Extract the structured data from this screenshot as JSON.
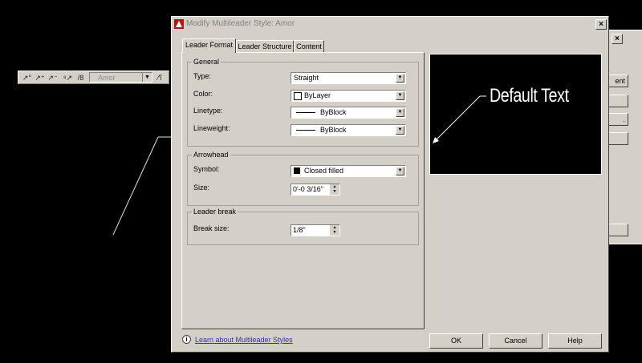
{
  "dialog": {
    "title": "Modify Multileader Style: Amor",
    "close_label": "×"
  },
  "tabs": [
    {
      "label": "Leader Format"
    },
    {
      "label": "Leader Structure"
    },
    {
      "label": "Content"
    }
  ],
  "general": {
    "legend": "General",
    "type_label": "Type:",
    "type_value": "Straight",
    "color_label": "Color:",
    "color_value": "ByLayer",
    "linetype_label": "Linetype:",
    "linetype_value": "ByBlock",
    "lineweight_label": "Lineweight:",
    "lineweight_value": "ByBlock"
  },
  "arrowhead": {
    "legend": "Arrowhead",
    "symbol_label": "Symbol:",
    "symbol_value": "Closed filled",
    "size_label": "Size:",
    "size_value": "0'-0 3/16\""
  },
  "leader_break": {
    "legend": "Leader break",
    "break_size_label": "Break size:",
    "break_size_value": "1/8\""
  },
  "preview": {
    "text": "Default Text"
  },
  "footer": {
    "learn_link": "Learn about Multileader Styles",
    "info_icon_glyph": "i",
    "ok_label": "OK",
    "cancel_label": "Cancel",
    "help_label": "Help"
  },
  "toolbar": {
    "style_value": "Amor"
  },
  "back_dialog": {
    "buttons": [
      "ent",
      "",
      ".",
      "",
      ""
    ]
  }
}
